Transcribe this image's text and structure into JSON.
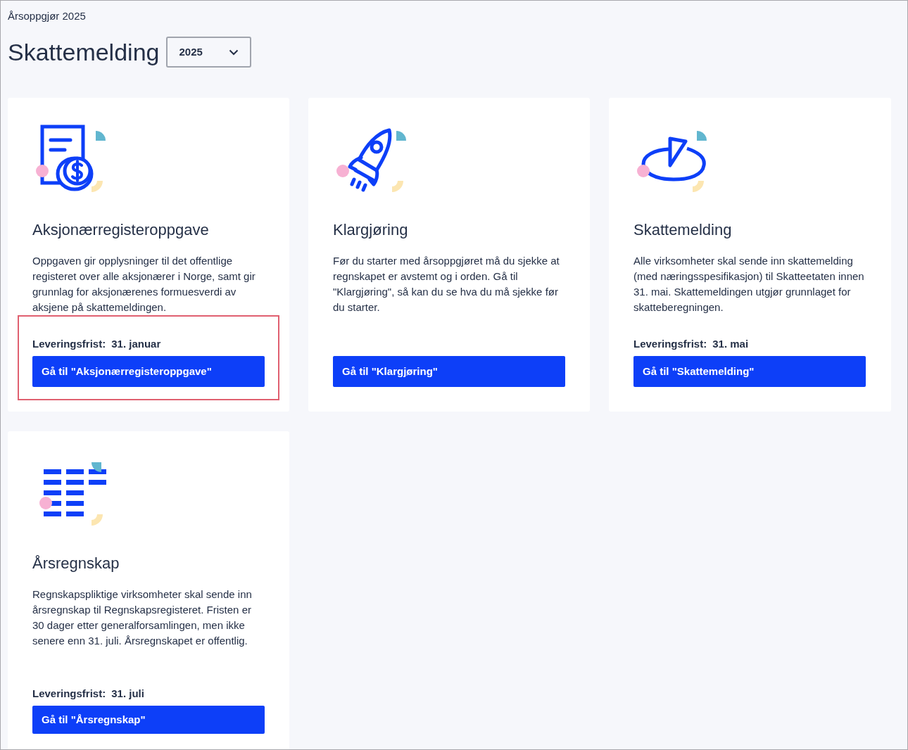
{
  "breadcrumb": "Årsoppgjør 2025",
  "heading": "Skattemelding",
  "year_select": {
    "value": "2025"
  },
  "cards": [
    {
      "title": "Aksjonærregisteroppgave",
      "description": "Oppgaven gir opplysninger til det offentlige registeret over alle aksjonærer i Norge, samt gir grunnlag for aksjonærenes formuesverdi av aksjene på skattemeldingen.",
      "deadline_label": "Leveringsfrist:",
      "deadline": "31. januar",
      "button": "Gå til \"Aksjonærregisteroppgave\"",
      "highlighted": true
    },
    {
      "title": "Klargjøring",
      "description": "Før du starter med årsoppgjøret må du sjekke at regnskapet er avstemt og i orden. Gå til \"Klargjøring\", så kan du se hva du må sjekke før du starter.",
      "button": "Gå til \"Klargjøring\"",
      "highlighted": false
    },
    {
      "title": "Skattemelding",
      "description": "Alle virksomheter skal sende inn skattemelding (med næringsspesifikasjon) til Skatteetaten innen 31. mai. Skattemeldingen utgjør grunnlaget for skatteberegningen.",
      "deadline_label": "Leveringsfrist:",
      "deadline": "31. mai",
      "button": "Gå til \"Skattemelding\"",
      "highlighted": false
    },
    {
      "title": "Årsregnskap",
      "description": "Regnskapspliktige virksomheter skal sende inn årsregnskap til Regnskapsregisteret. Fristen er 30 dager etter generalforsamlingen, men ikke senere enn 31. juli. Årsregnskapet er offentlig.",
      "deadline_label": "Leveringsfrist:",
      "deadline": "31. juli",
      "button": "Gå til \"Årsregnskap\"",
      "highlighted": false
    }
  ]
}
